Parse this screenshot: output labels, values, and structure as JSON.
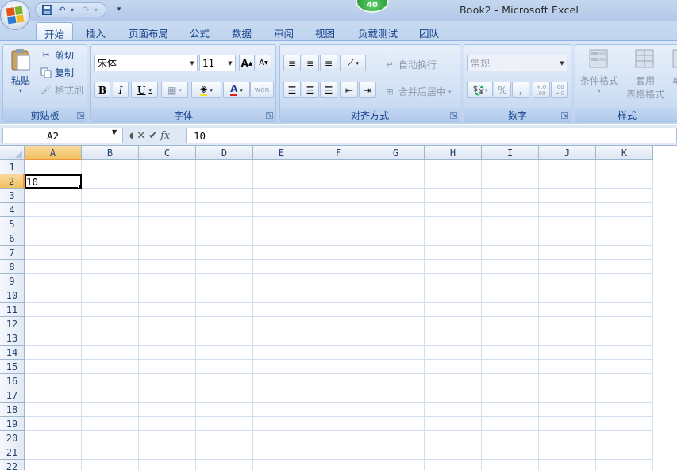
{
  "window": {
    "title": "Book2 - Microsoft Excel",
    "badge": "40"
  },
  "qat": {
    "save": "save-icon",
    "undo": "undo-icon",
    "redo": "redo-icon",
    "customize": "▾"
  },
  "tabs": [
    "开始",
    "插入",
    "页面布局",
    "公式",
    "数据",
    "审阅",
    "视图",
    "负载测试",
    "团队"
  ],
  "active_tab": "开始",
  "clipboard": {
    "label": "剪贴板",
    "paste": "粘贴",
    "cut": "剪切",
    "copy": "复制",
    "format_painter": "格式刷"
  },
  "font": {
    "label": "字体",
    "name": "宋体",
    "size": "11",
    "grow": "A",
    "shrink": "A",
    "bold": "B",
    "italic": "I",
    "underline": "U",
    "phonetic": "wén"
  },
  "alignment": {
    "label": "对齐方式",
    "wrap_text": "自动换行",
    "merge_center": "合并后居中"
  },
  "number": {
    "label": "数字",
    "format": "常规",
    "percent": "%",
    "comma": ",",
    "inc_decimal": "+.0 .00",
    "dec_decimal": ".00 →.0"
  },
  "styles": {
    "label": "样式",
    "conditional": "条件格式",
    "table_format_1": "套用",
    "table_format_2": "表格格式",
    "cell_styles": "单"
  },
  "formula_bar": {
    "name_box": "A2",
    "value": "10",
    "fx": "fx"
  },
  "sheet": {
    "columns": [
      "A",
      "B",
      "C",
      "D",
      "E",
      "F",
      "G",
      "H",
      "I",
      "J",
      "K"
    ],
    "rows": [
      "1",
      "2",
      "3",
      "4",
      "5",
      "6",
      "7",
      "8",
      "9",
      "10",
      "11",
      "12",
      "13",
      "14",
      "15",
      "16",
      "17",
      "18",
      "19",
      "20",
      "21",
      "22"
    ],
    "selected_column": "A",
    "selected_row": "2",
    "cells": {
      "A2": "10"
    }
  },
  "colors": {
    "accent": "#15428b",
    "selection": "#f1c15f"
  }
}
